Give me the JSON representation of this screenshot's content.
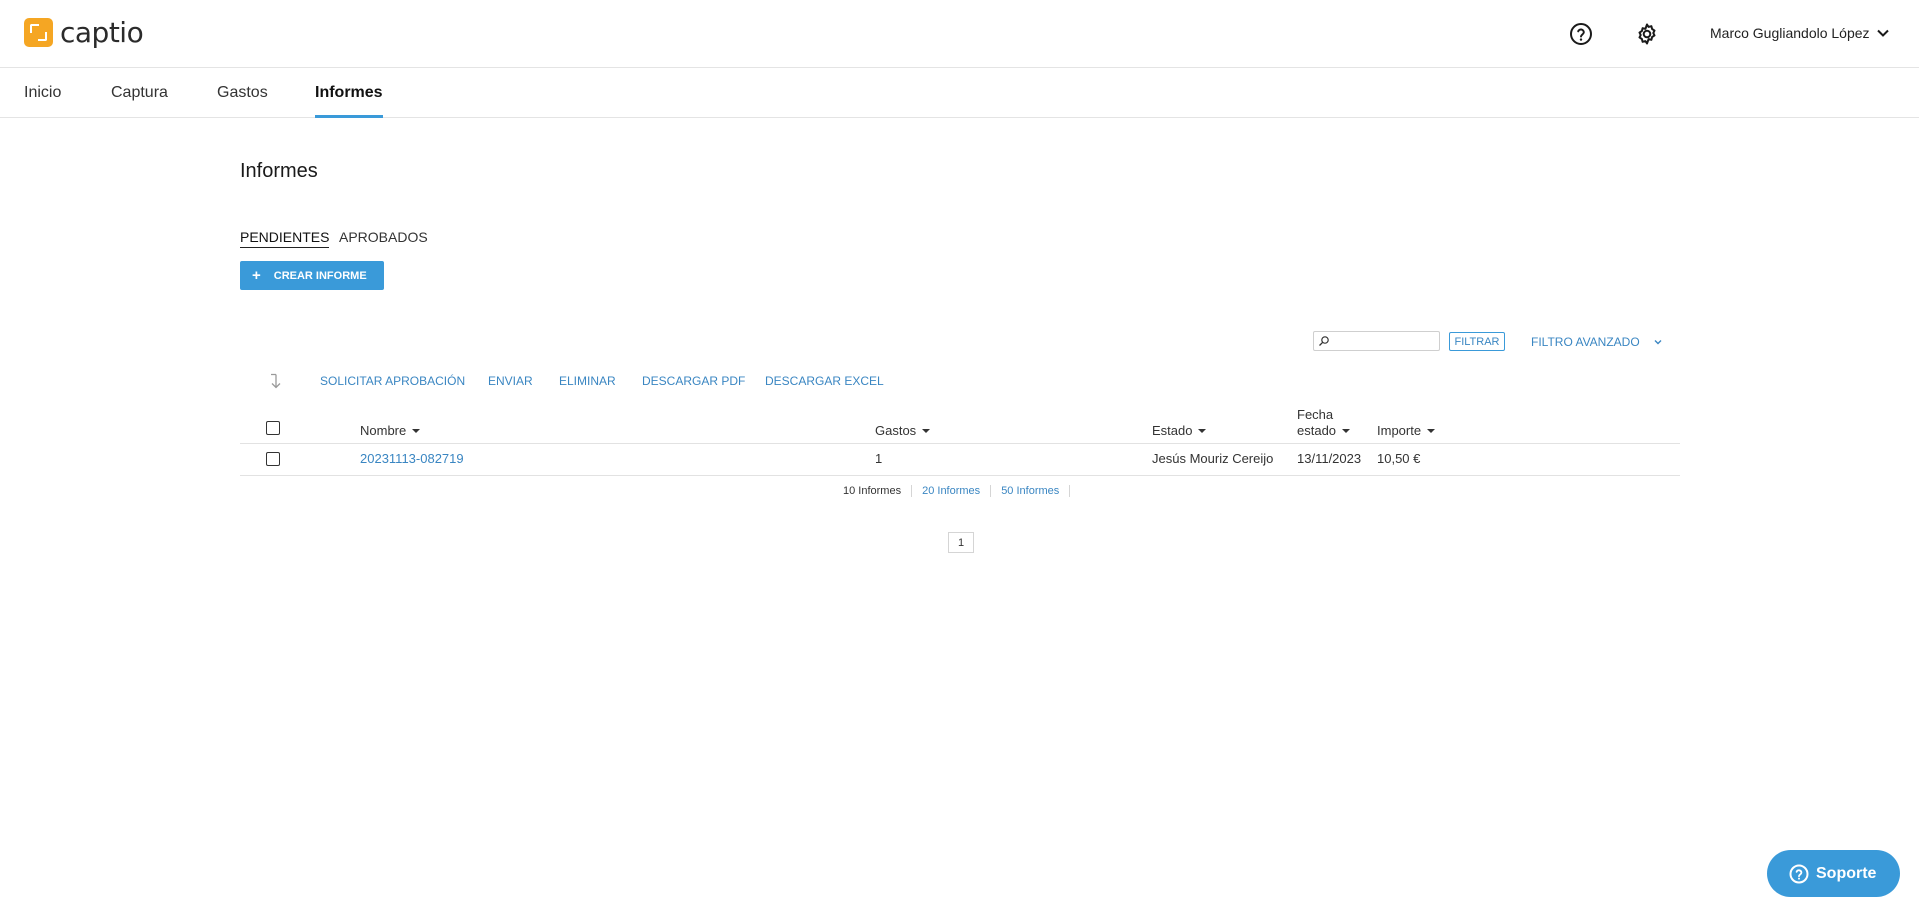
{
  "brand": {
    "name": "captio",
    "accent": "#f5a623"
  },
  "header": {
    "user_name": "Marco Gugliandolo López",
    "icons": [
      "help-icon",
      "gear-icon",
      "chevron-down-icon"
    ]
  },
  "nav": {
    "items": [
      {
        "label": "Inicio"
      },
      {
        "label": "Captura"
      },
      {
        "label": "Gastos"
      },
      {
        "label": "Informes",
        "active": true
      }
    ]
  },
  "main": {
    "title": "Informes",
    "subtabs": [
      {
        "label": "PENDIENTES",
        "active": true
      },
      {
        "label": "APROBADOS"
      }
    ],
    "create_button": {
      "icon": "+",
      "label": "CREAR INFORME"
    },
    "search": {
      "value": "",
      "placeholder": ""
    },
    "filter_button": "FILTRAR",
    "advanced_filter": "FILTRO AVANZADO",
    "actions": [
      "SOLICITAR APROBACIÓN",
      "ENVIAR",
      "ELIMINAR",
      "DESCARGAR PDF",
      "DESCARGAR EXCEL"
    ],
    "table": {
      "columns": {
        "nombre": "Nombre",
        "gastos": "Gastos",
        "estado": "Estado",
        "fecha_line1": "Fecha",
        "fecha_line2": "estado",
        "importe": "Importe"
      },
      "rows": [
        {
          "nombre": "20231113-082719",
          "gastos": "1",
          "estado": "Jesús Mouriz Cereijo",
          "fecha": "13/11/2023",
          "importe": "10,50 €"
        }
      ]
    },
    "page_sizes": [
      "10 Informes",
      "20 Informes",
      "50 Informes"
    ],
    "current_page": "1"
  },
  "support_button": {
    "label": "Soporte"
  },
  "colors": {
    "primary": "#3a9ad9",
    "link": "#3a86c2"
  }
}
